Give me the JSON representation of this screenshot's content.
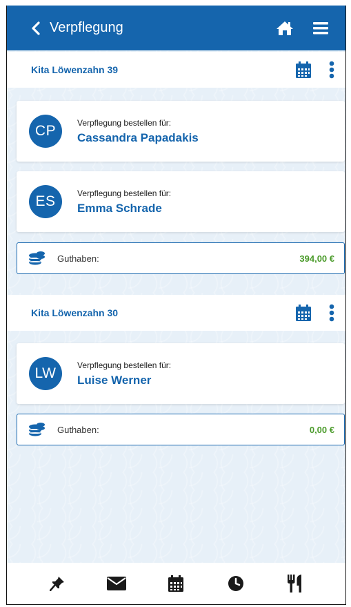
{
  "header": {
    "title": "Verpflegung"
  },
  "sections": [
    {
      "title": "Kita Löwenzahn 39",
      "children": [
        {
          "initials": "CP",
          "label": "Verpflegung bestellen für:",
          "name": "Cassandra Papadakis"
        },
        {
          "initials": "ES",
          "label": "Verpflegung bestellen für:",
          "name": "Emma Schrade"
        }
      ],
      "balance": {
        "label": "Guthaben:",
        "value": "394,00 €"
      }
    },
    {
      "title": "Kita Löwenzahn 30",
      "children": [
        {
          "initials": "LW",
          "label": "Verpflegung bestellen für:",
          "name": "Luise Werner"
        }
      ],
      "balance": {
        "label": "Guthaben:",
        "value": "0,00 €"
      }
    }
  ],
  "footer": {
    "tabs": [
      "pin-icon",
      "mail-icon",
      "calendar-icon",
      "clock-icon",
      "cutlery-icon"
    ]
  },
  "colors": {
    "primary": "#1565ad",
    "balance_green": "#4b9b2b",
    "background": "#e7f0f8"
  }
}
